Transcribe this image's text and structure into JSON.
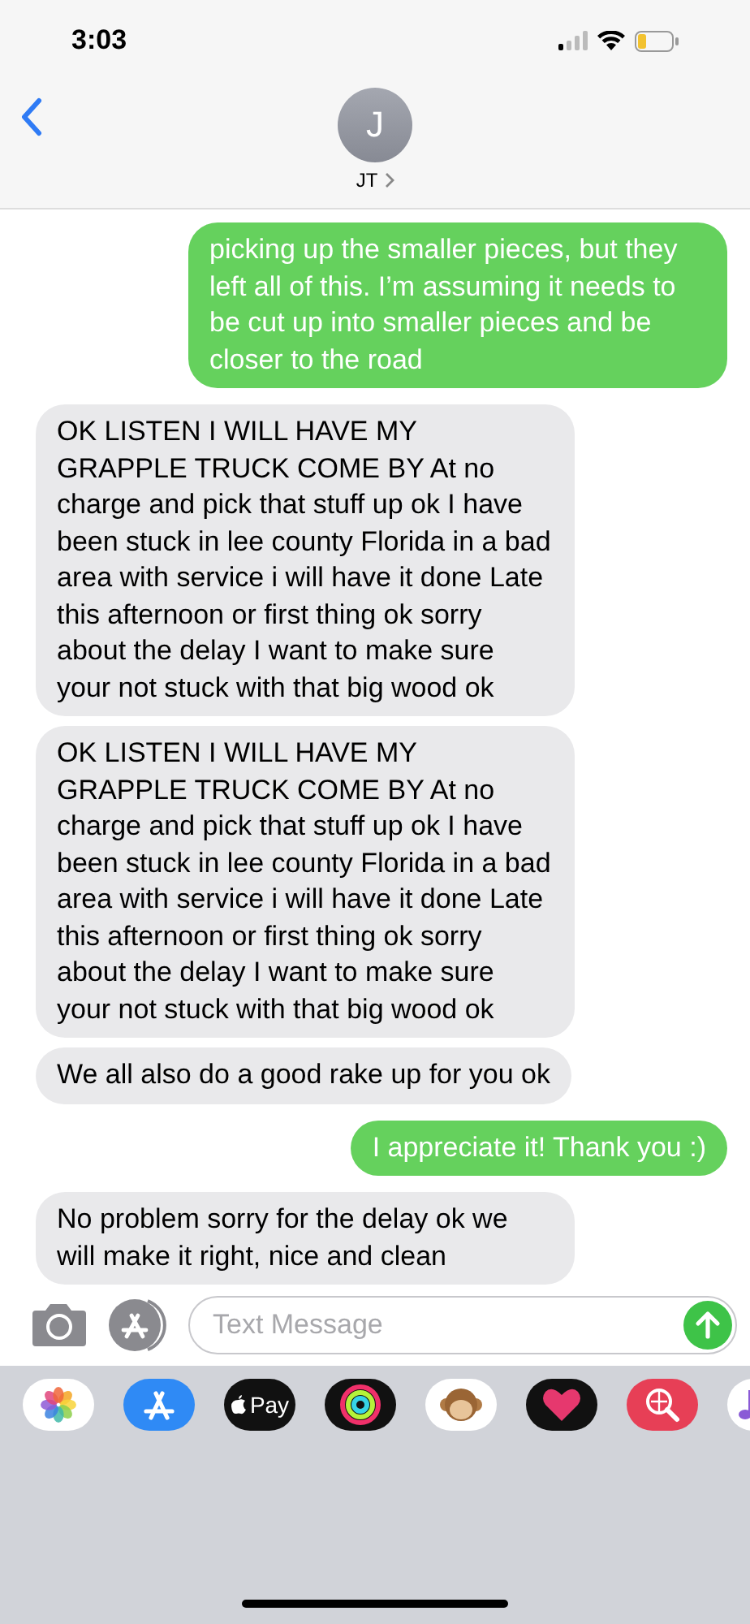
{
  "status_bar": {
    "time": "3:03"
  },
  "contact": {
    "initial": "J",
    "name": "JT"
  },
  "messages": [
    {
      "kind": "sent",
      "text": "picking up the smaller pieces, but they left all of this. I’m assuming it needs to be cut up into smaller pieces and be closer to the road"
    },
    {
      "kind": "received",
      "text": "OK LISTEN I WILL HAVE MY GRAPPLE TRUCK COME BY At no charge and pick that stuff up ok I have been stuck in lee county Florida in a bad area with service i will have it done Late this afternoon or first thing ok sorry about the delay I want to make sure your not stuck with that big wood ok"
    },
    {
      "kind": "received",
      "text": "OK LISTEN I WILL HAVE MY GRAPPLE TRUCK COME BY At no charge and pick that stuff up ok I have been stuck in lee county Florida in a bad area with service i will have it done Late this afternoon or first thing ok sorry about the delay I want to make sure your not stuck with that big wood ok"
    },
    {
      "kind": "received",
      "text": "We all also do a good rake up for you ok"
    },
    {
      "kind": "sent",
      "text": "I appreciate it! Thank you :)"
    },
    {
      "kind": "received",
      "text": "No problem sorry for the delay ok we will make it right, nice and clean"
    }
  ],
  "composer": {
    "placeholder": "Text Message"
  },
  "apps": [
    {
      "kind": "photos"
    },
    {
      "kind": "appstore"
    },
    {
      "kind": "pay",
      "label": "Pay"
    },
    {
      "kind": "activity"
    },
    {
      "kind": "memoji"
    },
    {
      "kind": "heart"
    },
    {
      "kind": "search"
    },
    {
      "kind": "music"
    }
  ]
}
